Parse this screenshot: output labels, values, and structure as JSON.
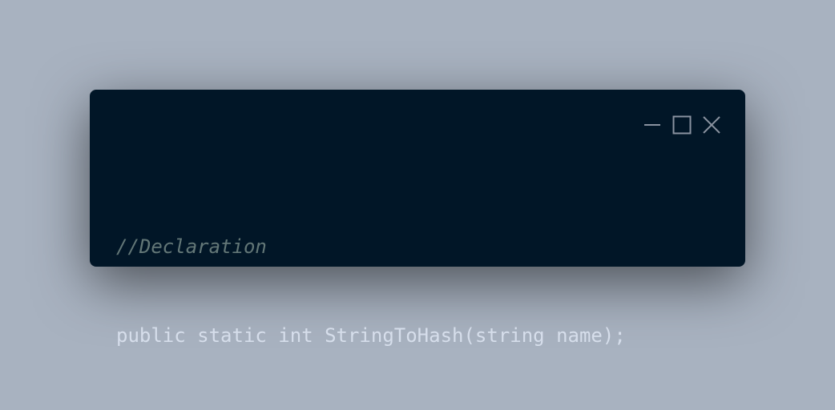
{
  "window": {
    "background": "#011627",
    "controls": [
      {
        "icon": "minimize-icon"
      },
      {
        "icon": "maximize-icon"
      },
      {
        "icon": "close-icon"
      }
    ]
  },
  "page": {
    "background": "#a8b2c0"
  },
  "code": {
    "language": "C#",
    "comment": "//Declaration",
    "declaration": "public static int StringToHash(string name);",
    "colors": {
      "comment": "#637777",
      "text": "#d6deeb"
    }
  }
}
